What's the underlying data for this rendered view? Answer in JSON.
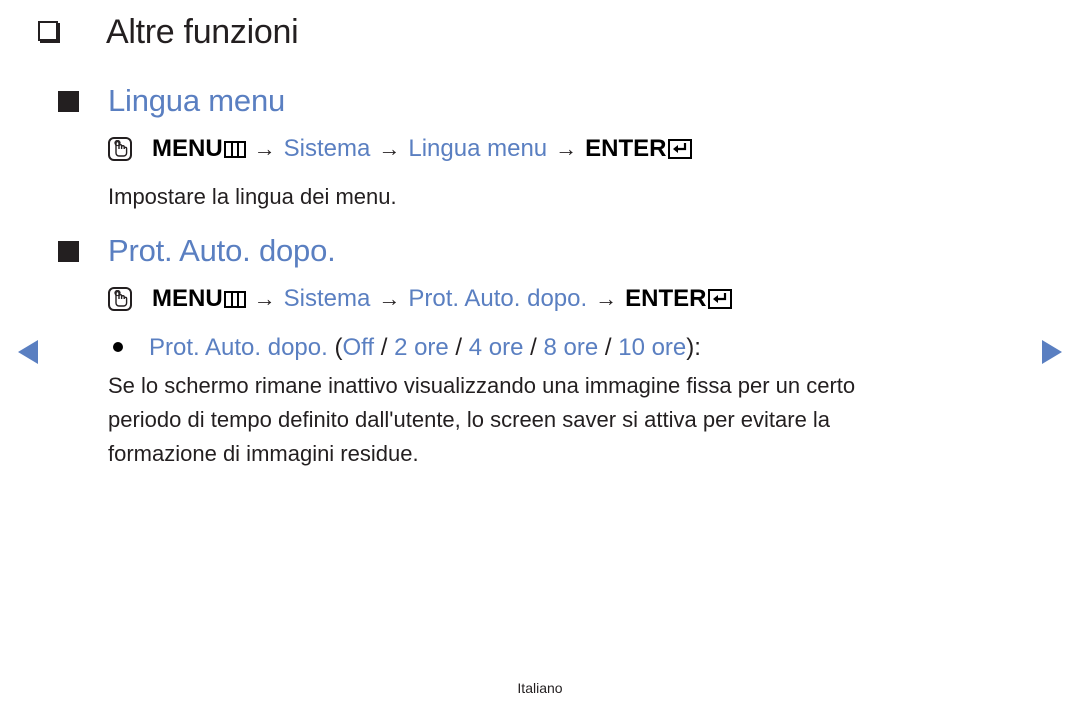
{
  "page": {
    "title": "Altre funzioni",
    "footer_language": "Italiano"
  },
  "colors": {
    "accent": "#5a7fc1",
    "text": "#231f20"
  },
  "sections": [
    {
      "heading": "Lingua menu",
      "path": {
        "hand_icon": "remote-hand-icon",
        "menu_label": "MENU",
        "menu_icon": "menu-grid-icon",
        "arrow": "→",
        "system": "Sistema",
        "item": "Lingua menu",
        "enter_label": "ENTER",
        "enter_icon": "enter-icon"
      },
      "description": "Impostare la lingua dei menu."
    },
    {
      "heading": "Prot. Auto. dopo.",
      "path": {
        "hand_icon": "remote-hand-icon",
        "menu_label": "MENU",
        "menu_icon": "menu-grid-icon",
        "arrow": "→",
        "system": "Sistema",
        "item": "Prot. Auto. dopo.",
        "enter_label": "ENTER",
        "enter_icon": "enter-icon"
      },
      "option": {
        "name": "Prot. Auto. dopo.",
        "open": "(",
        "values": [
          "Off",
          "2 ore",
          "4 ore",
          "8 ore",
          "10 ore"
        ],
        "separator": " / ",
        "close": "):"
      },
      "description_lines": [
        "Se lo schermo rimane inattivo visualizzando una immagine fissa per un certo",
        "periodo di tempo definito dall'utente, lo screen saver si attiva per evitare la",
        "formazione di immagini residue."
      ]
    }
  ],
  "navigation": {
    "prev_icon": "triangle-left-icon",
    "next_icon": "triangle-right-icon"
  }
}
